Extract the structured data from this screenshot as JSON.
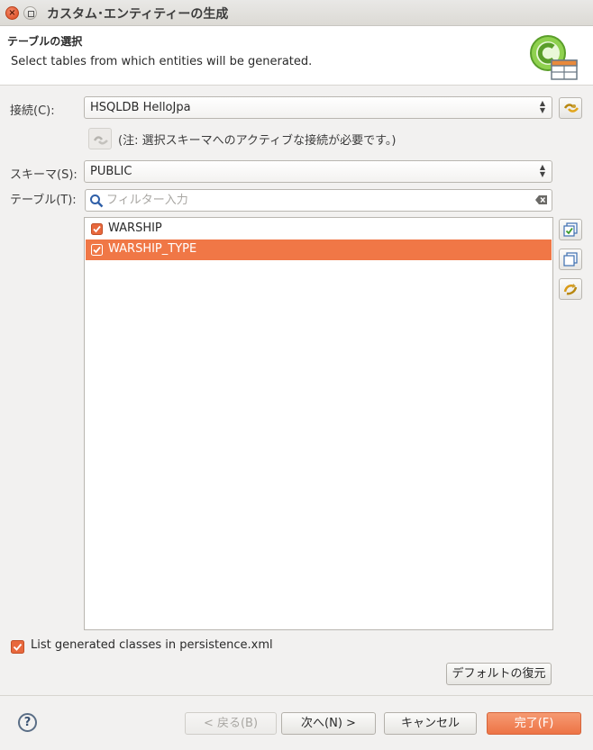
{
  "window": {
    "title": "カスタム･エンティティーの生成"
  },
  "banner": {
    "title": "テーブルの選択",
    "description": "Select tables from which entities will be generated."
  },
  "connection": {
    "label": "接続(C):",
    "value": "HSQLDB HelloJpa",
    "note": "(注: 選択スキーマへのアクティブな接続が必要です。)"
  },
  "schema": {
    "label": "スキーマ(S):",
    "value": "PUBLIC"
  },
  "tables": {
    "label": "テーブル(T):",
    "filter_placeholder": "フィルター入力",
    "items": [
      {
        "name": "WARSHIP",
        "checked": true,
        "selected": false
      },
      {
        "name": "WARSHIP_TYPE",
        "checked": true,
        "selected": true
      }
    ]
  },
  "options": {
    "persistence_label": "List generated classes in persistence.xml",
    "persistence_checked": true
  },
  "buttons": {
    "restore_defaults": "デフォルトの復元",
    "back": "< 戻る(B)",
    "next": "次へ(N) >",
    "cancel": "キャンセル",
    "finish": "完了(F)",
    "help": "?"
  },
  "colors": {
    "accent": "#f07746",
    "checkbox": "#e8683d"
  }
}
